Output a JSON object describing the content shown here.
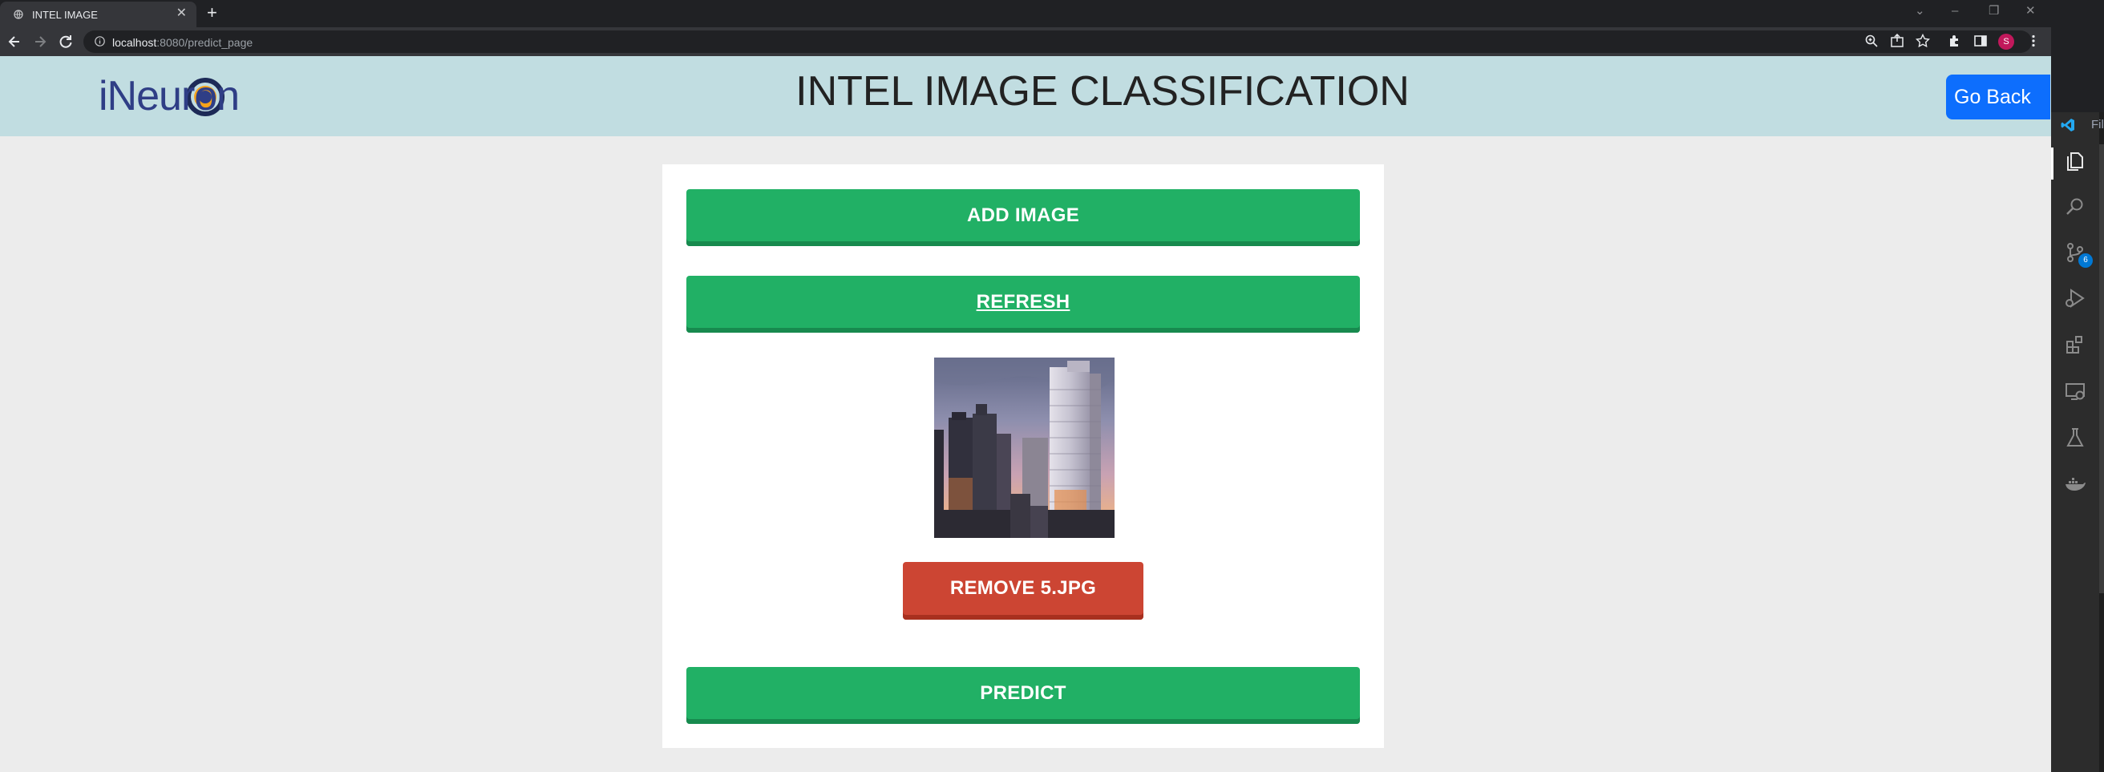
{
  "browser": {
    "tab_title": "INTEL IMAGE",
    "tab_close": "✕",
    "new_tab": "+",
    "url_host": "localhost",
    "url_path": ":8080/predict_page",
    "profile_initial": "S"
  },
  "header": {
    "logo_text": "iNeuron",
    "title": "INTEL IMAGE CLASSIFICATION",
    "go_back_label": "Go Back"
  },
  "card": {
    "add_image_label": "ADD IMAGE",
    "refresh_label": "REFRESH",
    "remove_label": "REMOVE 5.JPG",
    "predict_label": "PREDICT"
  },
  "vscode": {
    "title_fragment": "Fil",
    "source_control_badge": "6"
  },
  "colors": {
    "header_bg": "#c1dde1",
    "green_button": "#21b065",
    "red_button": "#cc4533",
    "go_back": "#0d6efd"
  }
}
